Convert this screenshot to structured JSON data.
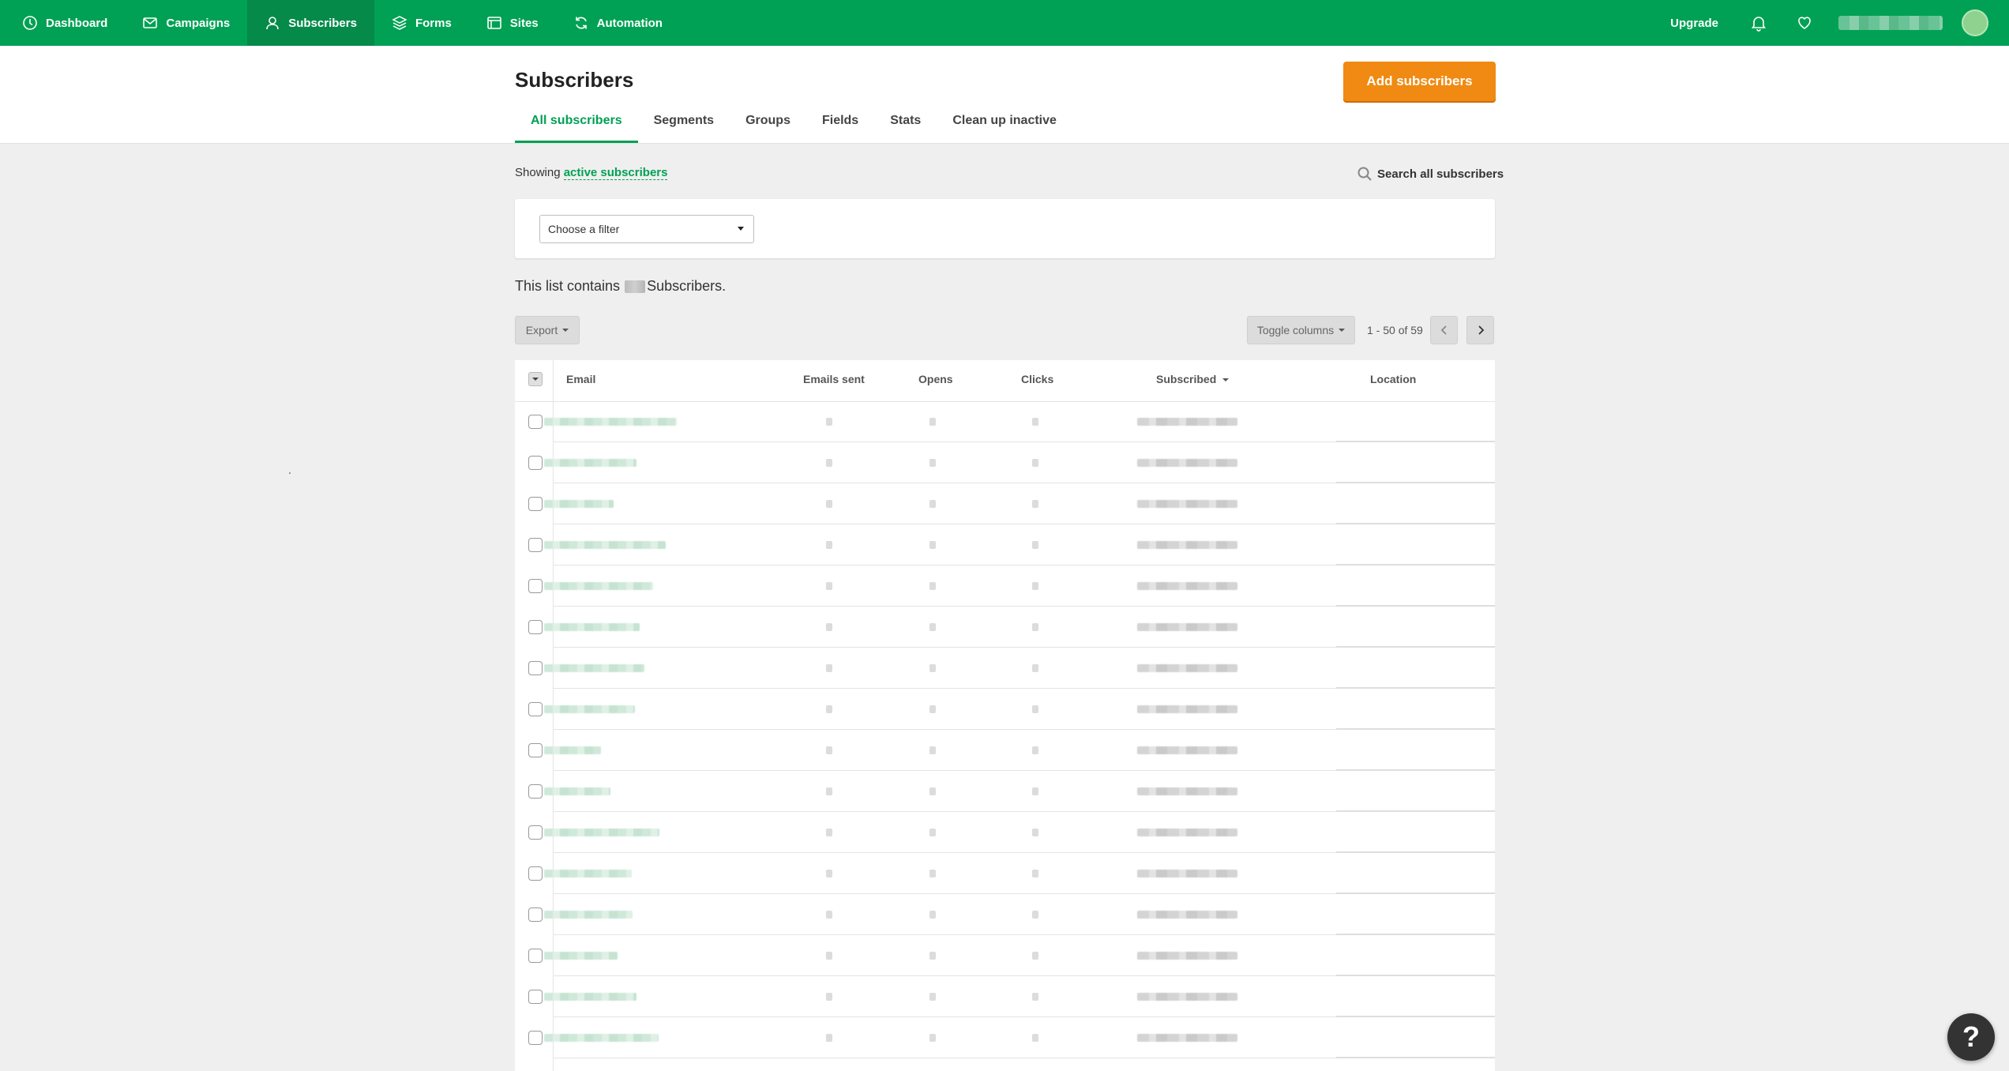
{
  "nav": {
    "items": [
      {
        "label": "Dashboard",
        "icon": "clock-icon"
      },
      {
        "label": "Campaigns",
        "icon": "envelope-icon"
      },
      {
        "label": "Subscribers",
        "icon": "user-icon"
      },
      {
        "label": "Forms",
        "icon": "layers-icon"
      },
      {
        "label": "Sites",
        "icon": "browser-icon"
      },
      {
        "label": "Automation",
        "icon": "refresh-icon"
      }
    ],
    "active": "Subscribers",
    "upgrade_label": "Upgrade"
  },
  "header": {
    "title": "Subscribers",
    "add_button": "Add subscribers",
    "tabs": [
      "All subscribers",
      "Segments",
      "Groups",
      "Fields",
      "Stats",
      "Clean up inactive"
    ],
    "active_tab": "All subscribers"
  },
  "toolbar": {
    "showing_prefix": "Showing",
    "showing_link": "active subscribers",
    "search_label": "Search all subscribers",
    "filter_placeholder": "Choose a filter",
    "list_prefix": "This list contains",
    "list_suffix": "Subscribers.",
    "export_label": "Export",
    "toggle_columns_label": "Toggle columns",
    "pagination": "1 - 50 of 59"
  },
  "table": {
    "columns": [
      "Email",
      "Emails sent",
      "Opens",
      "Clicks",
      "Subscribed",
      "Location"
    ],
    "sorted_column": "Subscribed",
    "row_count_visible": 16
  },
  "colors": {
    "brand_green": "#00a154",
    "accent_orange": "#f08a12"
  },
  "help_label": "?"
}
